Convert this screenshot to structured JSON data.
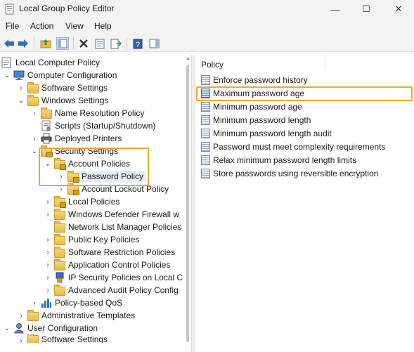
{
  "window": {
    "title": "Local Group Policy Editor",
    "minimize_glyph": "—",
    "maximize_glyph": "☐",
    "close_glyph": "✕"
  },
  "menu": {
    "file": "File",
    "action": "Action",
    "view": "View",
    "help": "Help"
  },
  "toolbar": {
    "icons": [
      "back-arrow-icon",
      "forward-arrow-icon",
      "up-folder-icon",
      "show-hide-tree-icon",
      "delete-icon",
      "properties-icon",
      "export-list-icon",
      "help-icon",
      "show-pane-icon"
    ]
  },
  "tree": {
    "items": [
      {
        "label": "Local Computer Policy"
      },
      {
        "label": "Computer Configuration"
      },
      {
        "label": "Software Settings"
      },
      {
        "label": "Windows Settings"
      },
      {
        "label": "Name Resolution Policy"
      },
      {
        "label": "Scripts (Startup/Shutdown)"
      },
      {
        "label": "Deployed Printers"
      },
      {
        "label": "Security Settings"
      },
      {
        "label": "Account Policies"
      },
      {
        "label": "Password Policy"
      },
      {
        "label": "Account Lockout Policy"
      },
      {
        "label": "Local Policies"
      },
      {
        "label": "Windows Defender Firewall w"
      },
      {
        "label": "Network List Manager Policies"
      },
      {
        "label": "Public Key Policies"
      },
      {
        "label": "Software Restriction Policies"
      },
      {
        "label": "Application Control Policies"
      },
      {
        "label": "IP Security Policies on Local C"
      },
      {
        "label": "Advanced Audit Policy Config"
      },
      {
        "label": "Policy-based QoS"
      },
      {
        "label": "Administrative Templates"
      },
      {
        "label": "User Configuration"
      },
      {
        "label": "Software Settings"
      }
    ]
  },
  "list": {
    "column_header": "Policy",
    "rows": [
      {
        "label": "Enforce password history"
      },
      {
        "label": "Maximum password age"
      },
      {
        "label": "Minimum password age"
      },
      {
        "label": "Minimum password length"
      },
      {
        "label": "Minimum password length audit"
      },
      {
        "label": "Password must meet complexity requirements"
      },
      {
        "label": "Relax minimum password length limits"
      },
      {
        "label": "Store passwords using reversible encryption"
      }
    ]
  },
  "colors": {
    "highlight": "#f2a91f",
    "selection": "#e5eef9",
    "chrome": "#f3f3f3"
  }
}
